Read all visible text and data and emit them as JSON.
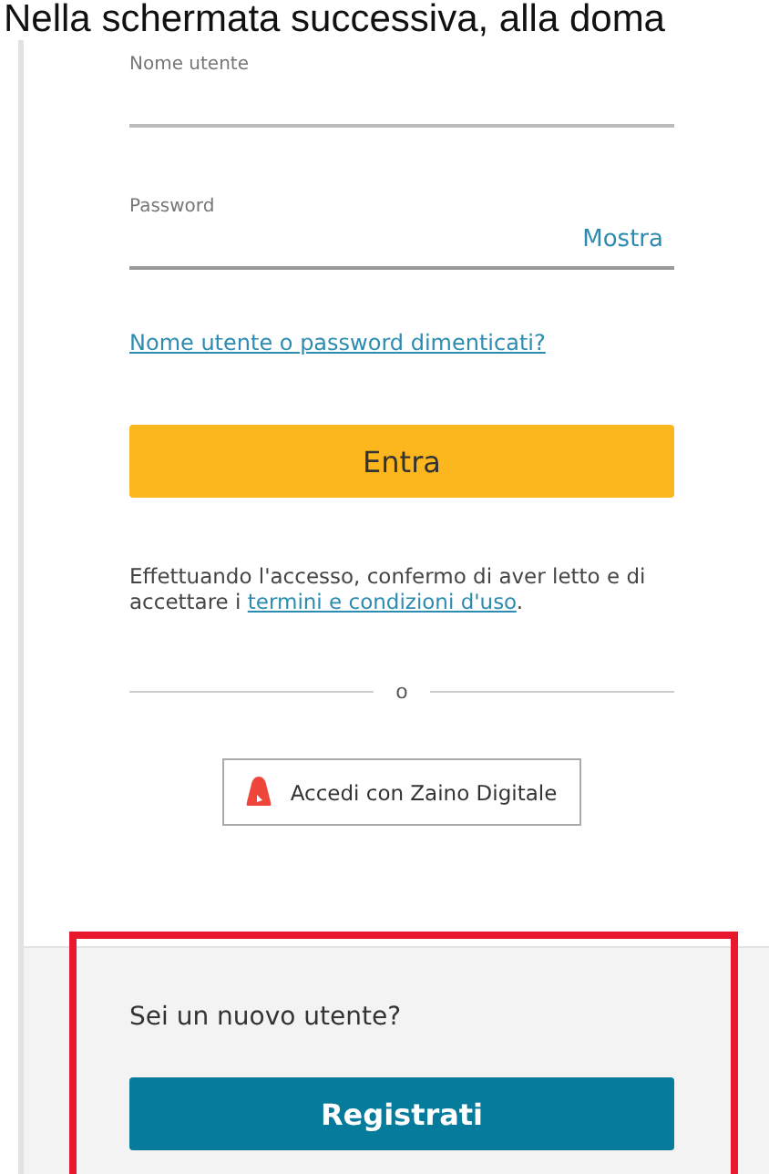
{
  "caption": "Nella schermata successiva, alla doma",
  "login_form": {
    "username": {
      "label": "Nome utente"
    },
    "password": {
      "label": "Password",
      "toggle": "Mostra"
    },
    "forgot_link": "Nome utente o password dimenticati?",
    "submit_button": "Entra",
    "terms": {
      "text": "Effettuando l'accesso, confermo di aver letto e di accettare i ",
      "link": "termini e condizioni d'uso",
      "end": "."
    },
    "separator": "o",
    "alt_login_button": "Accedi con Zaino Digitale"
  },
  "register_section": {
    "question": "Sei un nuovo utente?",
    "button": "Registrati"
  }
}
